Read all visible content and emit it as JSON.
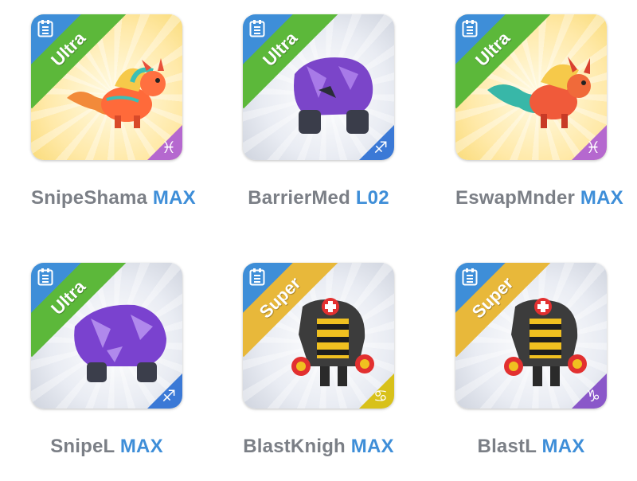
{
  "cards": [
    {
      "name": "SnipeShama",
      "level": "MAX",
      "rarity": "Ultra",
      "background": "yellow",
      "element": "pisces-icon",
      "element_glyph": "♓",
      "badge_color": "#b568cf",
      "creature": "dragon-icon"
    },
    {
      "name": "BarrierMed",
      "level": "L02",
      "rarity": "Ultra",
      "background": "grey",
      "element": "sagittarius-icon",
      "element_glyph": "♐",
      "badge_color": "#3b79d6",
      "creature": "rock-golem-icon"
    },
    {
      "name": "EswapMnder",
      "level": "MAX",
      "rarity": "Ultra",
      "background": "yellow",
      "element": "pisces-icon",
      "element_glyph": "♓",
      "badge_color": "#b568cf",
      "creature": "dragon-icon"
    },
    {
      "name": "SnipeL",
      "level": "MAX",
      "rarity": "Ultra",
      "background": "grey",
      "element": "sagittarius-icon",
      "element_glyph": "♐",
      "badge_color": "#3b79d6",
      "creature": "rock-golem-icon"
    },
    {
      "name": "BlastKnigh",
      "level": "MAX",
      "rarity": "Super",
      "background": "grey",
      "element": "cancer-icon",
      "element_glyph": "♋",
      "badge_color": "#d8c11a",
      "creature": "robot-knight-icon"
    },
    {
      "name": "BlastL",
      "level": "MAX",
      "rarity": "Super",
      "background": "grey",
      "element": "capricorn-icon",
      "element_glyph": "♑",
      "badge_color": "#8a57c9",
      "creature": "robot-knight-icon"
    }
  ]
}
